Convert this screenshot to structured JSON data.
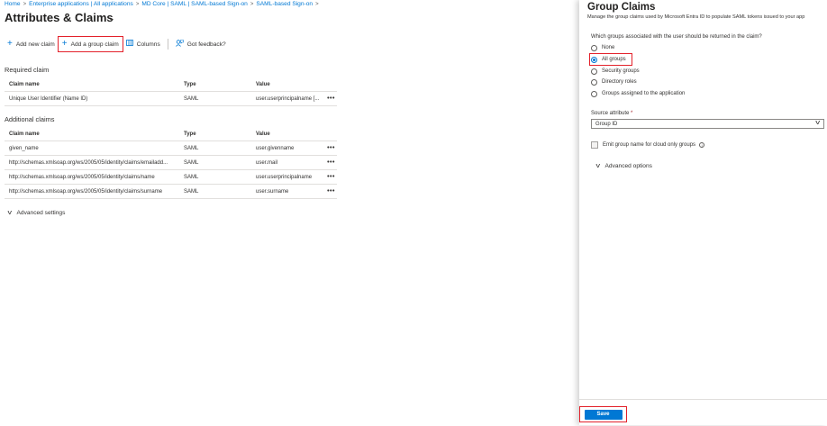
{
  "breadcrumb": [
    "Home",
    "Enterprise applications | All applications",
    "MD Core | SAML | SAML-based Sign-on",
    "SAML-based Sign-on"
  ],
  "breadcrumb_separator": ">",
  "page": {
    "title": "Attributes & Claims",
    "more_label": "..."
  },
  "toolbar": {
    "add_new_claim": "Add new claim",
    "add_group_claim": "Add a group claim",
    "columns": "Columns",
    "feedback": "Got feedback?"
  },
  "required": {
    "title": "Required claim",
    "headers": [
      "Claim name",
      "Type",
      "Value"
    ],
    "rows": [
      {
        "name": "Unique User Identifier (Name ID)",
        "type": "SAML",
        "value": "user.userprincipalname [..."
      }
    ]
  },
  "additional": {
    "title": "Additional claims",
    "headers": [
      "Claim name",
      "Type",
      "Value"
    ],
    "rows": [
      {
        "name": "given_name",
        "type": "SAML",
        "value": "user.givenname"
      },
      {
        "name": "http://schemas.xmlsoap.org/ws/2005/05/identity/claims/emailadd...",
        "type": "SAML",
        "value": "user.mail"
      },
      {
        "name": "http://schemas.xmlsoap.org/ws/2005/05/identity/claims/name",
        "type": "SAML",
        "value": "user.userprincipalname"
      },
      {
        "name": "http://schemas.xmlsoap.org/ws/2005/05/identity/claims/surname",
        "type": "SAML",
        "value": "user.surname"
      }
    ]
  },
  "row_more": "•••",
  "advanced_settings": "Advanced settings",
  "panel": {
    "title": "Group Claims",
    "description": "Manage the group claims used by Microsoft Entra ID to populate SAML tokens issued to your app",
    "question": "Which groups associated with the user should be returned in the claim?",
    "options": [
      "None",
      "All groups",
      "Security groups",
      "Directory roles",
      "Groups assigned to the application"
    ],
    "selected": "All groups",
    "source_label": "Source attribute",
    "required_mark": "*",
    "source_value": "Group ID",
    "emit_label": "Emit group name for cloud only groups",
    "advanced_options": "Advanced options",
    "save": "Save"
  },
  "colors": {
    "accent": "#0078d4",
    "highlight": "#e3212b"
  }
}
